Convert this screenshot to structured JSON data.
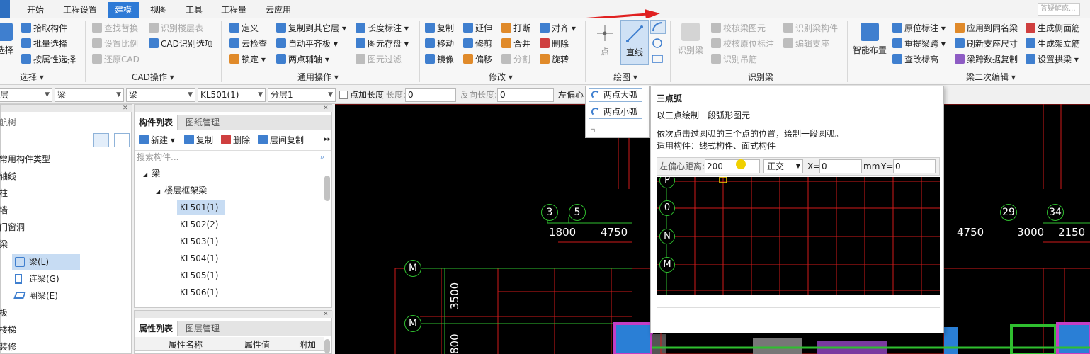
{
  "menu": {
    "tabs": [
      "开始",
      "工程设置",
      "建模",
      "视图",
      "工具",
      "工程量",
      "云应用"
    ],
    "active_tab": "建模",
    "search_placeholder": "答疑解惑..."
  },
  "ribbon": {
    "select": {
      "big_label": "选择",
      "items": [
        "拾取构件",
        "批量选择",
        "按属性选择"
      ],
      "group_label": "选择 ▾"
    },
    "cad": {
      "items": [
        "查找替换",
        "设置比例",
        "还原CAD",
        "识别楼层表",
        "CAD识别选项"
      ],
      "group_label": "CAD操作 ▾"
    },
    "common": {
      "items": [
        "定义",
        "云检查",
        "锁定 ▾",
        "复制到其它层 ▾",
        "自动平齐板 ▾",
        "两点辅轴 ▾",
        "长度标注 ▾",
        "图元存盘 ▾",
        "图元过滤"
      ],
      "group_label": "通用操作 ▾"
    },
    "modify": {
      "items": [
        "复制",
        "移动",
        "镜像",
        "延伸",
        "修剪",
        "偏移",
        "打断",
        "合并",
        "分割",
        "对齐 ▾",
        "删除",
        "旋转"
      ],
      "group_label": "修改 ▾"
    },
    "draw": {
      "items": [
        "点",
        "直线"
      ],
      "group_label": "绘图 ▾"
    },
    "identify_beam": {
      "items": [
        "识别梁",
        "校核梁图元",
        "校核原位标注",
        "识别吊筋",
        "识别梁构件",
        "编辑支座"
      ],
      "group_label": "识别梁"
    },
    "beam_edit": {
      "items": [
        "智能布置",
        "原位标注 ▾",
        "重提梁跨 ▾",
        "查改标高",
        "应用到同名梁",
        "刷新支座尺寸",
        "梁跨数据复制",
        "生成侧面筋",
        "生成架立筋",
        "设置拱梁 ▾"
      ],
      "group_label": "梁二次编辑 ▾"
    }
  },
  "propbar": {
    "layer": "层",
    "type1": "梁",
    "type2": "梁",
    "name": "KL501(1)",
    "sublayer": "分层1",
    "point_length_label": "点加长度",
    "length_label": "长度:",
    "length_value": "0",
    "reverse_label": "反向长度:",
    "reverse_value": "0",
    "offset_label": "左偏心"
  },
  "nav": {
    "title": "航树",
    "items": [
      "常用构件类型",
      "轴线",
      "柱",
      "墙",
      "门窗洞",
      "梁",
      "梁(L)",
      "连梁(G)",
      "圈梁(E)",
      "板",
      "楼梯",
      "装修"
    ]
  },
  "component_list": {
    "tabs": [
      "构件列表",
      "图纸管理"
    ],
    "toolbar": [
      "新建 ▾",
      "复制",
      "删除",
      "层间复制"
    ],
    "search_placeholder": "搜索构件...",
    "tree_root": "梁",
    "tree_group": "楼层框架梁",
    "items": [
      "KL501(1)",
      "KL502(2)",
      "KL503(1)",
      "KL504(1)",
      "KL505(1)",
      "KL506(1)"
    ],
    "selected": "KL501(1)"
  },
  "attr_list": {
    "tabs": [
      "属性列表",
      "图层管理"
    ],
    "columns": [
      "属性名称",
      "属性值",
      "附加"
    ]
  },
  "arc_popup": {
    "items": [
      "两点大弧",
      "两点小弧"
    ]
  },
  "tooltip": {
    "title": "三点弧",
    "desc": "以三点绘制一段弧形图元",
    "detail1": "依次点击过圆弧的三个点的位置，绘制一段圆弧。",
    "detail2": "适用构件：线式构件、面式构件",
    "offset_label": "左偏心距离:",
    "offset_value": "200",
    "mode": "正交",
    "x_label": "X=",
    "x_value": "0",
    "unit": "mm",
    "y_label": "Y=",
    "y_value": "0",
    "preview_axes": [
      "P",
      "0",
      "N",
      "M"
    ]
  },
  "cad": {
    "axis_top": [
      "3",
      "5",
      "29",
      "34"
    ],
    "axis_left": [
      "M",
      "M"
    ],
    "dims_top": [
      "1800",
      "4750",
      "4750",
      "3000",
      "2150"
    ],
    "dims_left": [
      "3500",
      "800"
    ]
  },
  "colors": {
    "accent": "#2e7ad6",
    "cad_bg": "#000000",
    "grid_red": "#d11a1a",
    "axis_green": "#2fbf2f"
  }
}
